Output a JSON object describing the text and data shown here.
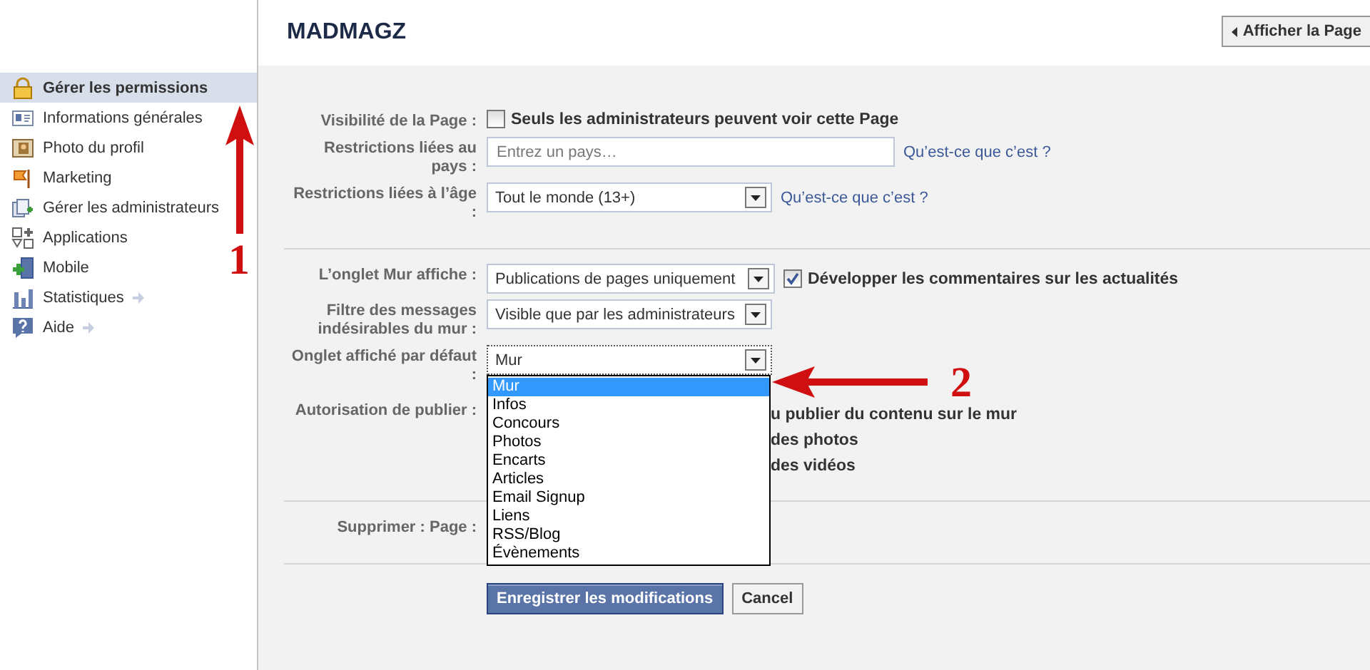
{
  "header": {
    "title": "MADMAGZ",
    "view_button": "Afficher la Page"
  },
  "sidebar": {
    "items": [
      {
        "label": "Gérer les permissions",
        "selected": true,
        "more": false
      },
      {
        "label": "Informations générales",
        "selected": false,
        "more": false
      },
      {
        "label": "Photo du profil",
        "selected": false,
        "more": false
      },
      {
        "label": "Marketing",
        "selected": false,
        "more": false
      },
      {
        "label": "Gérer les administrateurs",
        "selected": false,
        "more": false
      },
      {
        "label": "Applications",
        "selected": false,
        "more": false
      },
      {
        "label": "Mobile",
        "selected": false,
        "more": false
      },
      {
        "label": "Statistiques",
        "selected": false,
        "more": true
      },
      {
        "label": "Aide",
        "selected": false,
        "more": true
      }
    ]
  },
  "sections": [
    {
      "rows": [
        {
          "kind": "checkbox",
          "label": "Visibilité de la Page :",
          "checkbox_label": "Seuls les administrateurs peuvent voir cette Page",
          "checked": false
        },
        {
          "kind": "text",
          "label": "Restrictions liées au pays :",
          "placeholder": "Entrez un pays…",
          "help": "Qu’est-ce que c’est ?"
        },
        {
          "kind": "select",
          "label": "Restrictions liées à l’âge :",
          "value": "Tout le monde (13+)",
          "help": "Qu’est-ce que c’est ?"
        }
      ]
    },
    {
      "rows": [
        {
          "kind": "select",
          "label": "L’onglet Mur affiche :",
          "value": "Publications de pages uniquement",
          "checkbox_label": "Développer les commentaires sur les actualités",
          "checked": true
        },
        {
          "kind": "select",
          "label": "Filtre des messages indésirables du mur :",
          "value": "Visible que par les administrateurs"
        },
        {
          "kind": "open-select",
          "label": "Onglet affiché par défaut :",
          "value": "Mur",
          "options": [
            {
              "text": "Mur",
              "selected": true
            },
            {
              "text": "Infos",
              "selected": false
            },
            {
              "text": "Concours",
              "selected": false
            },
            {
              "text": "Photos",
              "selected": false
            },
            {
              "text": "Encarts",
              "selected": false
            },
            {
              "text": "Articles",
              "selected": false
            },
            {
              "text": "Email Signup",
              "selected": false
            },
            {
              "text": "Liens",
              "selected": false
            },
            {
              "text": "RSS/Blog",
              "selected": false
            },
            {
              "text": "Évènements",
              "selected": false
            }
          ]
        },
        {
          "kind": "fragments",
          "label": "Autorisation de publier :",
          "lines": [
            "u publier du contenu sur le mur",
            "des photos",
            "des vidéos"
          ]
        }
      ]
    },
    {
      "rows": [
        {
          "kind": "plain",
          "label": "Supprimer : Page :"
        }
      ]
    }
  ],
  "buttons": {
    "save": "Enregistrer les modifications",
    "cancel": "Cancel"
  },
  "annotations": [
    {
      "label": "1"
    },
    {
      "label": "2"
    }
  ]
}
